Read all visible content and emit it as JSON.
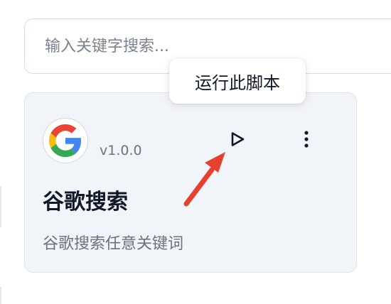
{
  "search": {
    "placeholder": "输入关键字搜索..."
  },
  "script_card": {
    "logo_icon": "google-g-icon",
    "version": "v1.0.0",
    "title": "谷歌搜索",
    "description": "谷歌搜索任意关键词",
    "run_icon": "play-icon",
    "more_icon": "more-vertical-icon"
  },
  "tooltip": {
    "text": "运行此脚本"
  },
  "annotation": {
    "arrow_color": "#e8402f"
  },
  "colors": {
    "google_blue": "#4285F4",
    "google_red": "#EA4335",
    "google_yellow": "#FBBC05",
    "google_green": "#34A853",
    "card_background": "#f1f4f9"
  }
}
